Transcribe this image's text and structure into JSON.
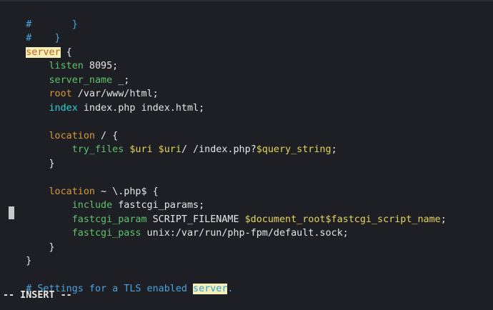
{
  "editor": {
    "lines": [
      {
        "hash": "#",
        "rest": "       }"
      },
      {
        "hash": "#",
        "rest": "    }"
      }
    ],
    "server_kw": "server",
    "brace_open": " {",
    "listen_kw": "listen",
    "listen_val": " 8095;",
    "server_name_kw": "server_name",
    "server_name_val": " _;",
    "root_kw": "root",
    "root_val": " /var/www/html;",
    "index_kw": "index",
    "index_val": " index.php index.html;",
    "location1_kw": "location",
    "location1_val": " / {",
    "try_files_kw": "try_files",
    "try_files_v1": " $uri",
    "try_files_v2": " $uri",
    "try_files_v3": "/ /index.php?",
    "try_files_v4": "$query_string",
    "try_files_v5": ";",
    "close1": "}",
    "location2_kw": "location",
    "location2_val": " ~ \\.php$ {",
    "include_kw": "include",
    "include_val": " fastcgi_params;",
    "fastcgi_param_kw": "fastcgi_param",
    "fastcgi_param_v1": " SCRIPT_FILENAME ",
    "fastcgi_param_v2": "$document_root$fastcgi_script_name",
    "fastcgi_param_v3": ";",
    "fastcgi_pass_kw": "fastcgi_pass",
    "fastcgi_pass_val": " unix:/var/run/php-fpm/default.sock;",
    "close2": "}",
    "close3": "}",
    "tls_comment": "# Settings for a TLS enabled ",
    "tls_server": "server",
    "tls_dot": "."
  },
  "status": {
    "mode": "-- INSERT --"
  }
}
